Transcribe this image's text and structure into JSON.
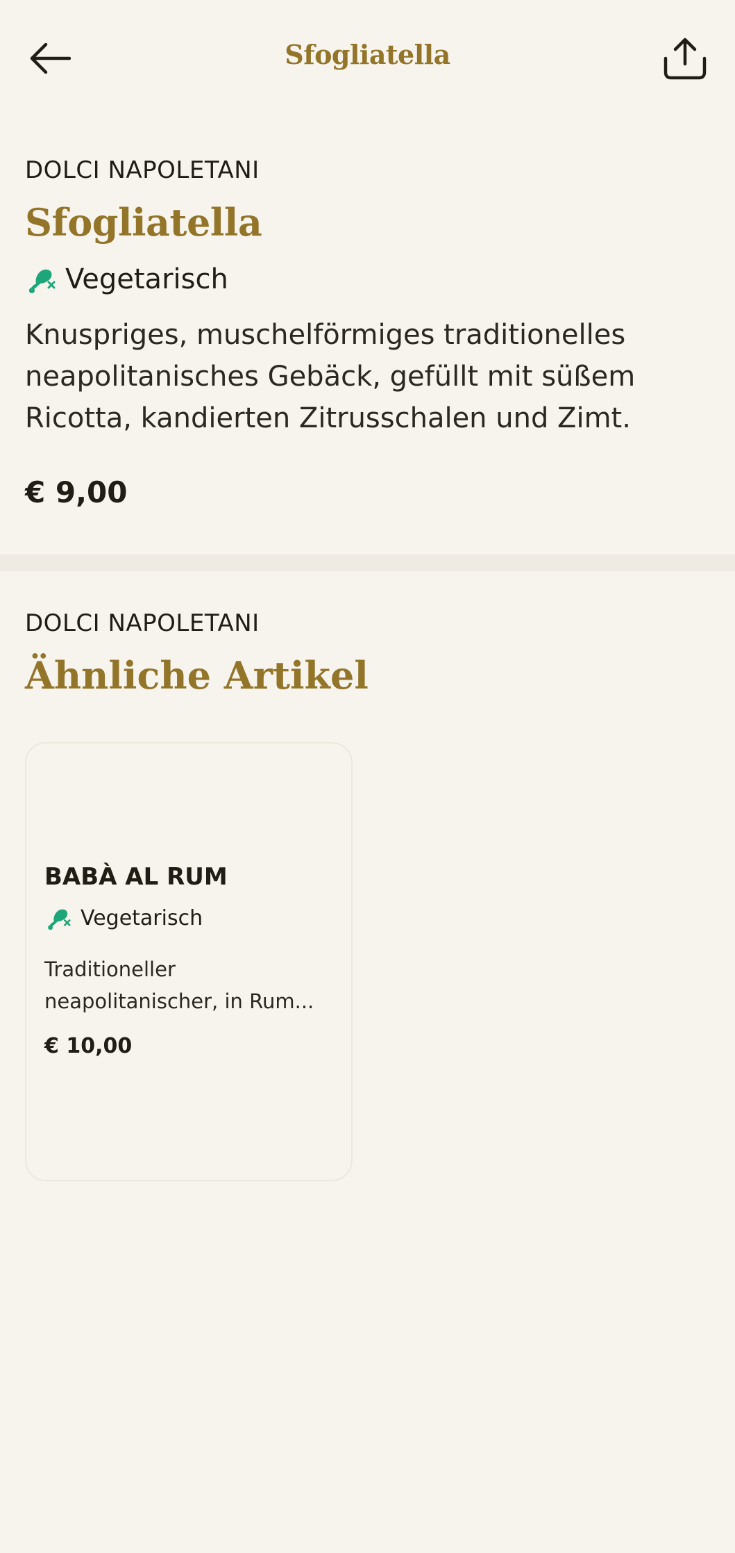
{
  "header": {
    "title": "Sfogliatella",
    "back_icon": "arrow-left-icon",
    "share_icon": "share-upload-icon"
  },
  "product": {
    "category": "DOLCI NAPOLETANI",
    "name": "Sfogliatella",
    "diet_label": "Vegetarisch",
    "diet_icon": "no-meat-icon",
    "description": "Knuspriges, muschelförmiges traditionelles neapolitanisches Gebäck, gefüllt mit süßem Ricotta, kandierten Zitrusschalen und Zimt.",
    "price": "€ 9,00"
  },
  "similar": {
    "category": "DOLCI NAPOLETANI",
    "title": "Ähnliche Artikel",
    "items": [
      {
        "name": "BABÀ AL RUM",
        "diet_label": "Vegetarisch",
        "description": "Traditioneller neapolitanischer, in Rum...",
        "price": "€ 10,00"
      }
    ]
  },
  "colors": {
    "background": "#f7f4ee",
    "accent_gold": "#93752a",
    "diet_green": "#1ea67a",
    "text": "#1f1d14"
  }
}
